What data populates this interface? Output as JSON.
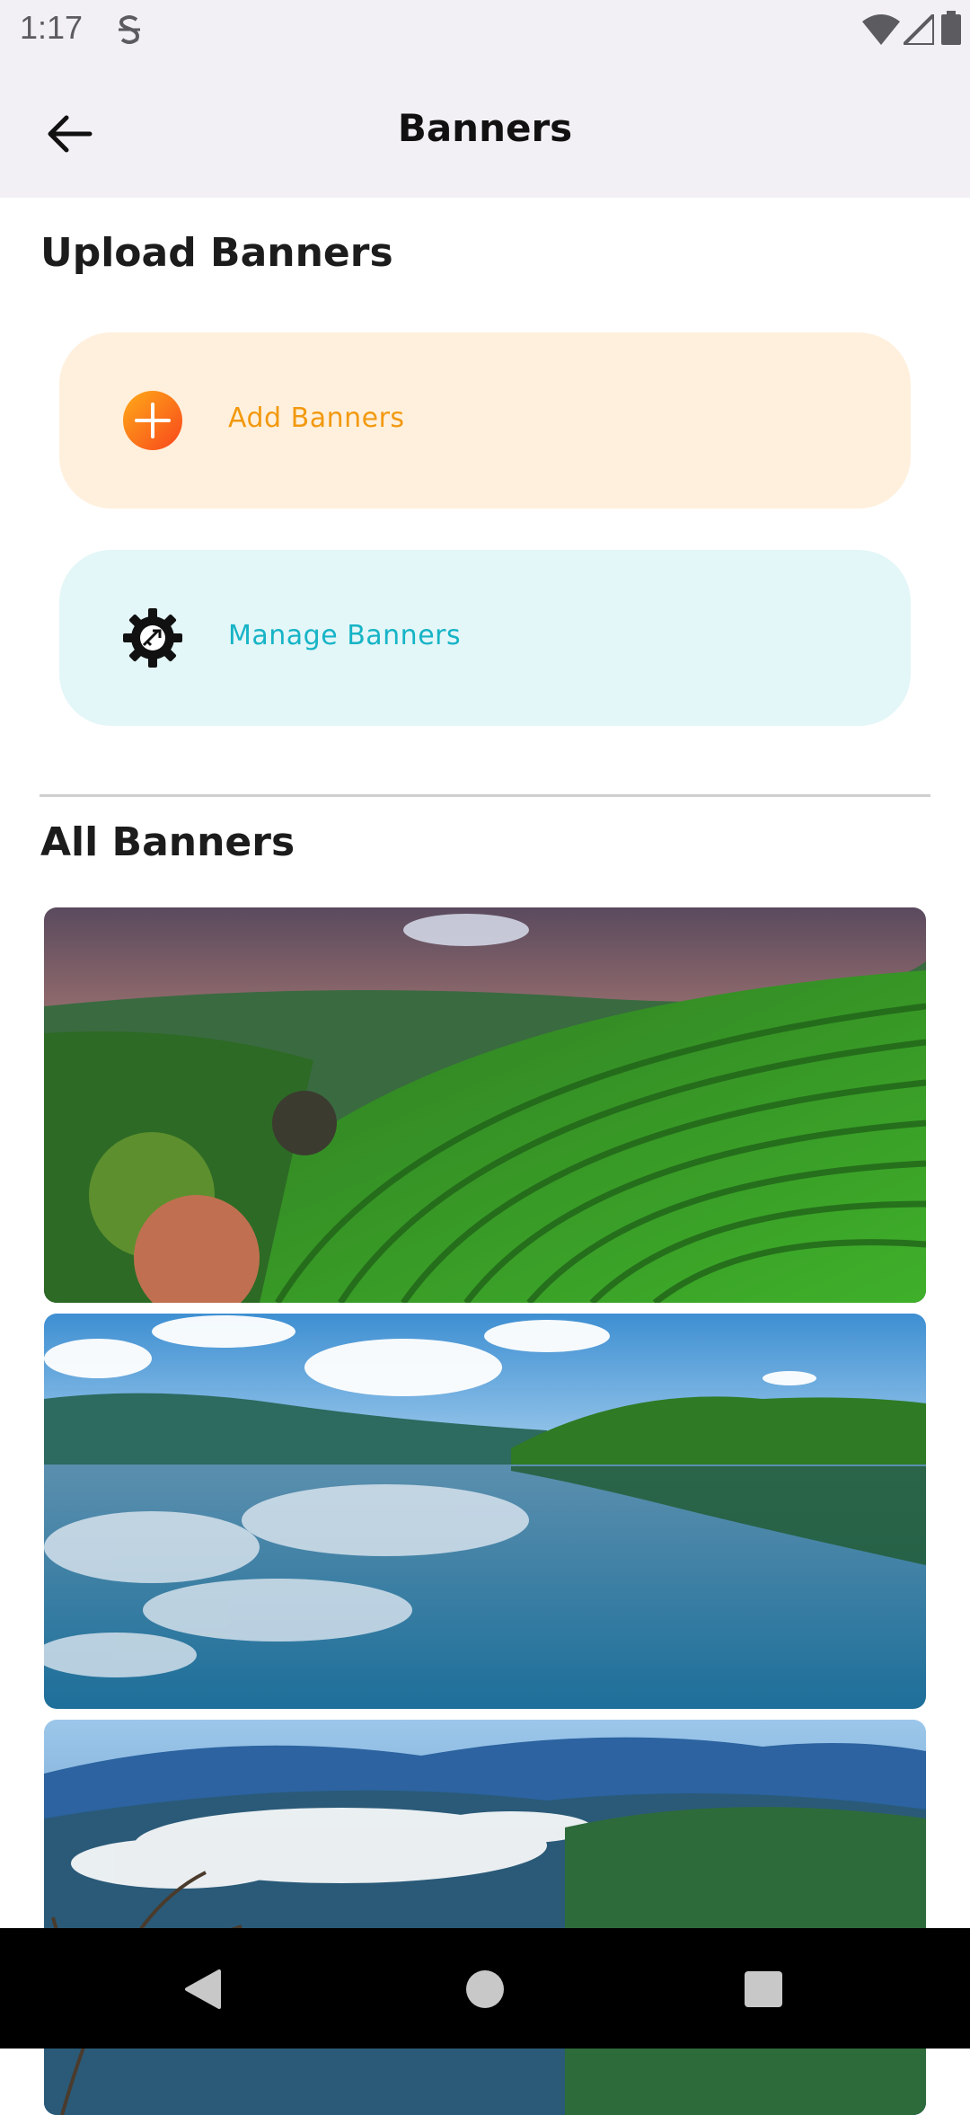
{
  "status_bar": {
    "time": "1:17",
    "icons": [
      "s-icon",
      "wifi-icon",
      "signal-icon",
      "battery-icon"
    ]
  },
  "app_bar": {
    "title": "Banners",
    "back_icon": "arrow-left-icon"
  },
  "upload_section": {
    "title": "Upload Banners",
    "add": {
      "label": "Add Banners",
      "icon": "plus-circle-icon",
      "color": "#f2990f",
      "bg": "#fff0dd"
    },
    "manage": {
      "label": "Manage Banners",
      "icon": "gear-icon",
      "color": "#16b4c6",
      "bg": "#e3f6f8"
    }
  },
  "all_section": {
    "title": "All Banners",
    "banners": [
      {
        "subject": "tea plantation terraces"
      },
      {
        "subject": "lake with reflected clouds"
      },
      {
        "subject": "misty mountains"
      }
    ]
  },
  "nav_bar": {
    "icons": [
      "nav-back-icon",
      "nav-home-icon",
      "nav-recents-icon"
    ]
  }
}
